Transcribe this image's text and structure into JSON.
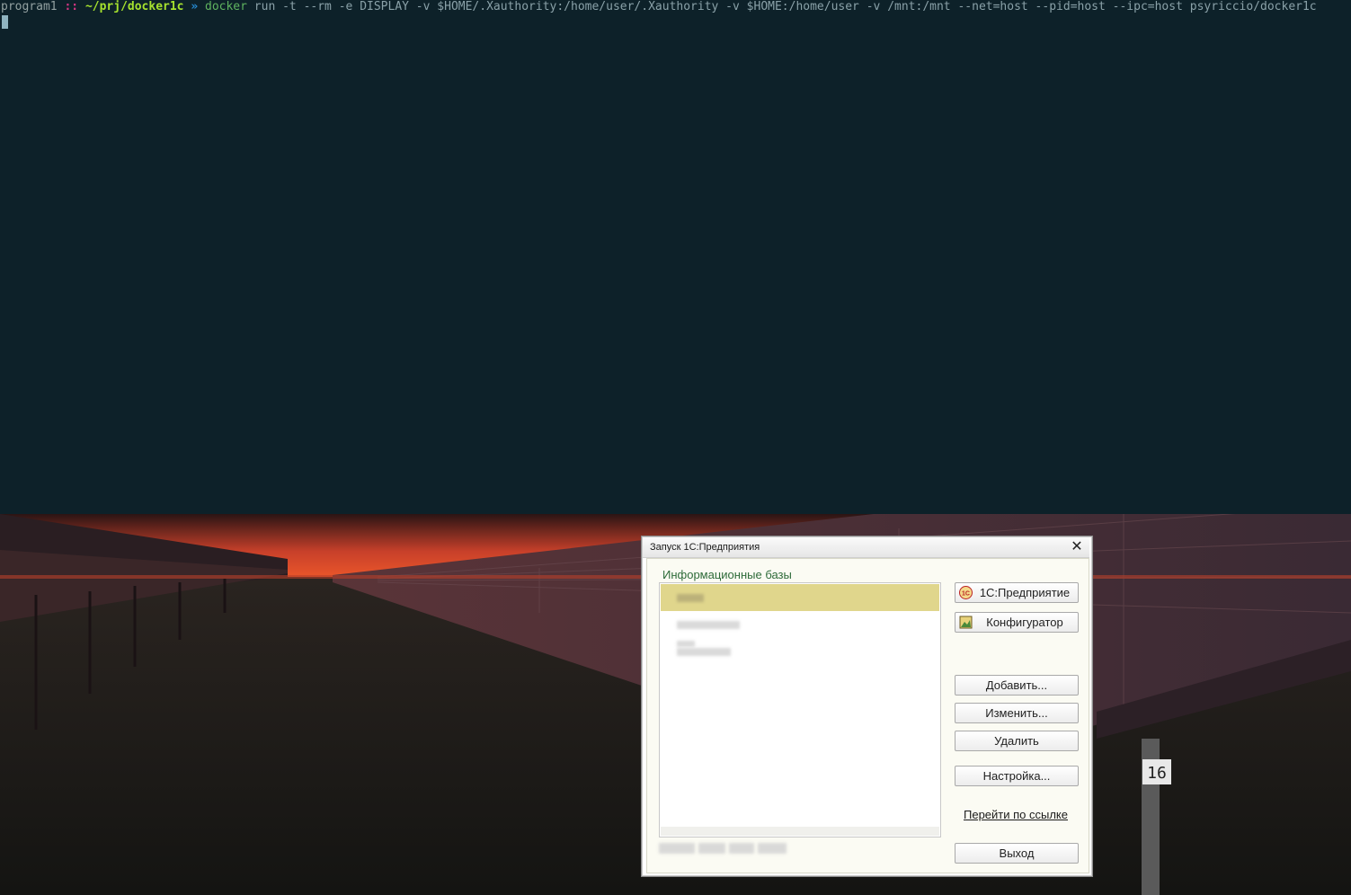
{
  "terminal": {
    "host": "program1",
    "separator": "::",
    "path": "~/prj/docker1c",
    "arrow": "»",
    "command": "docker",
    "args": " run -t --rm -e DISPLAY -v $HOME/.Xauthority:/home/user/.Xauthority -v $HOME:/home/user -v /mnt:/mnt --net=host --pid=host --ipc=host psyriccio/docker1c"
  },
  "dialog": {
    "title": "Запуск 1С:Предприятия",
    "section_label": "Информационные базы",
    "buttons": {
      "enterprise": "1С:Предприятие",
      "configurator": "Конфигуратор",
      "add": "Добавить...",
      "edit": "Изменить...",
      "delete": "Удалить",
      "settings": "Настройка...",
      "exit": "Выход"
    },
    "link": "Перейти по ссылке"
  },
  "wallpaper": {
    "sign_number": "16"
  },
  "colors": {
    "terminal_bg": "#0d2129",
    "selected_row": "#e0d68c",
    "section_label": "#2e6b3a"
  }
}
